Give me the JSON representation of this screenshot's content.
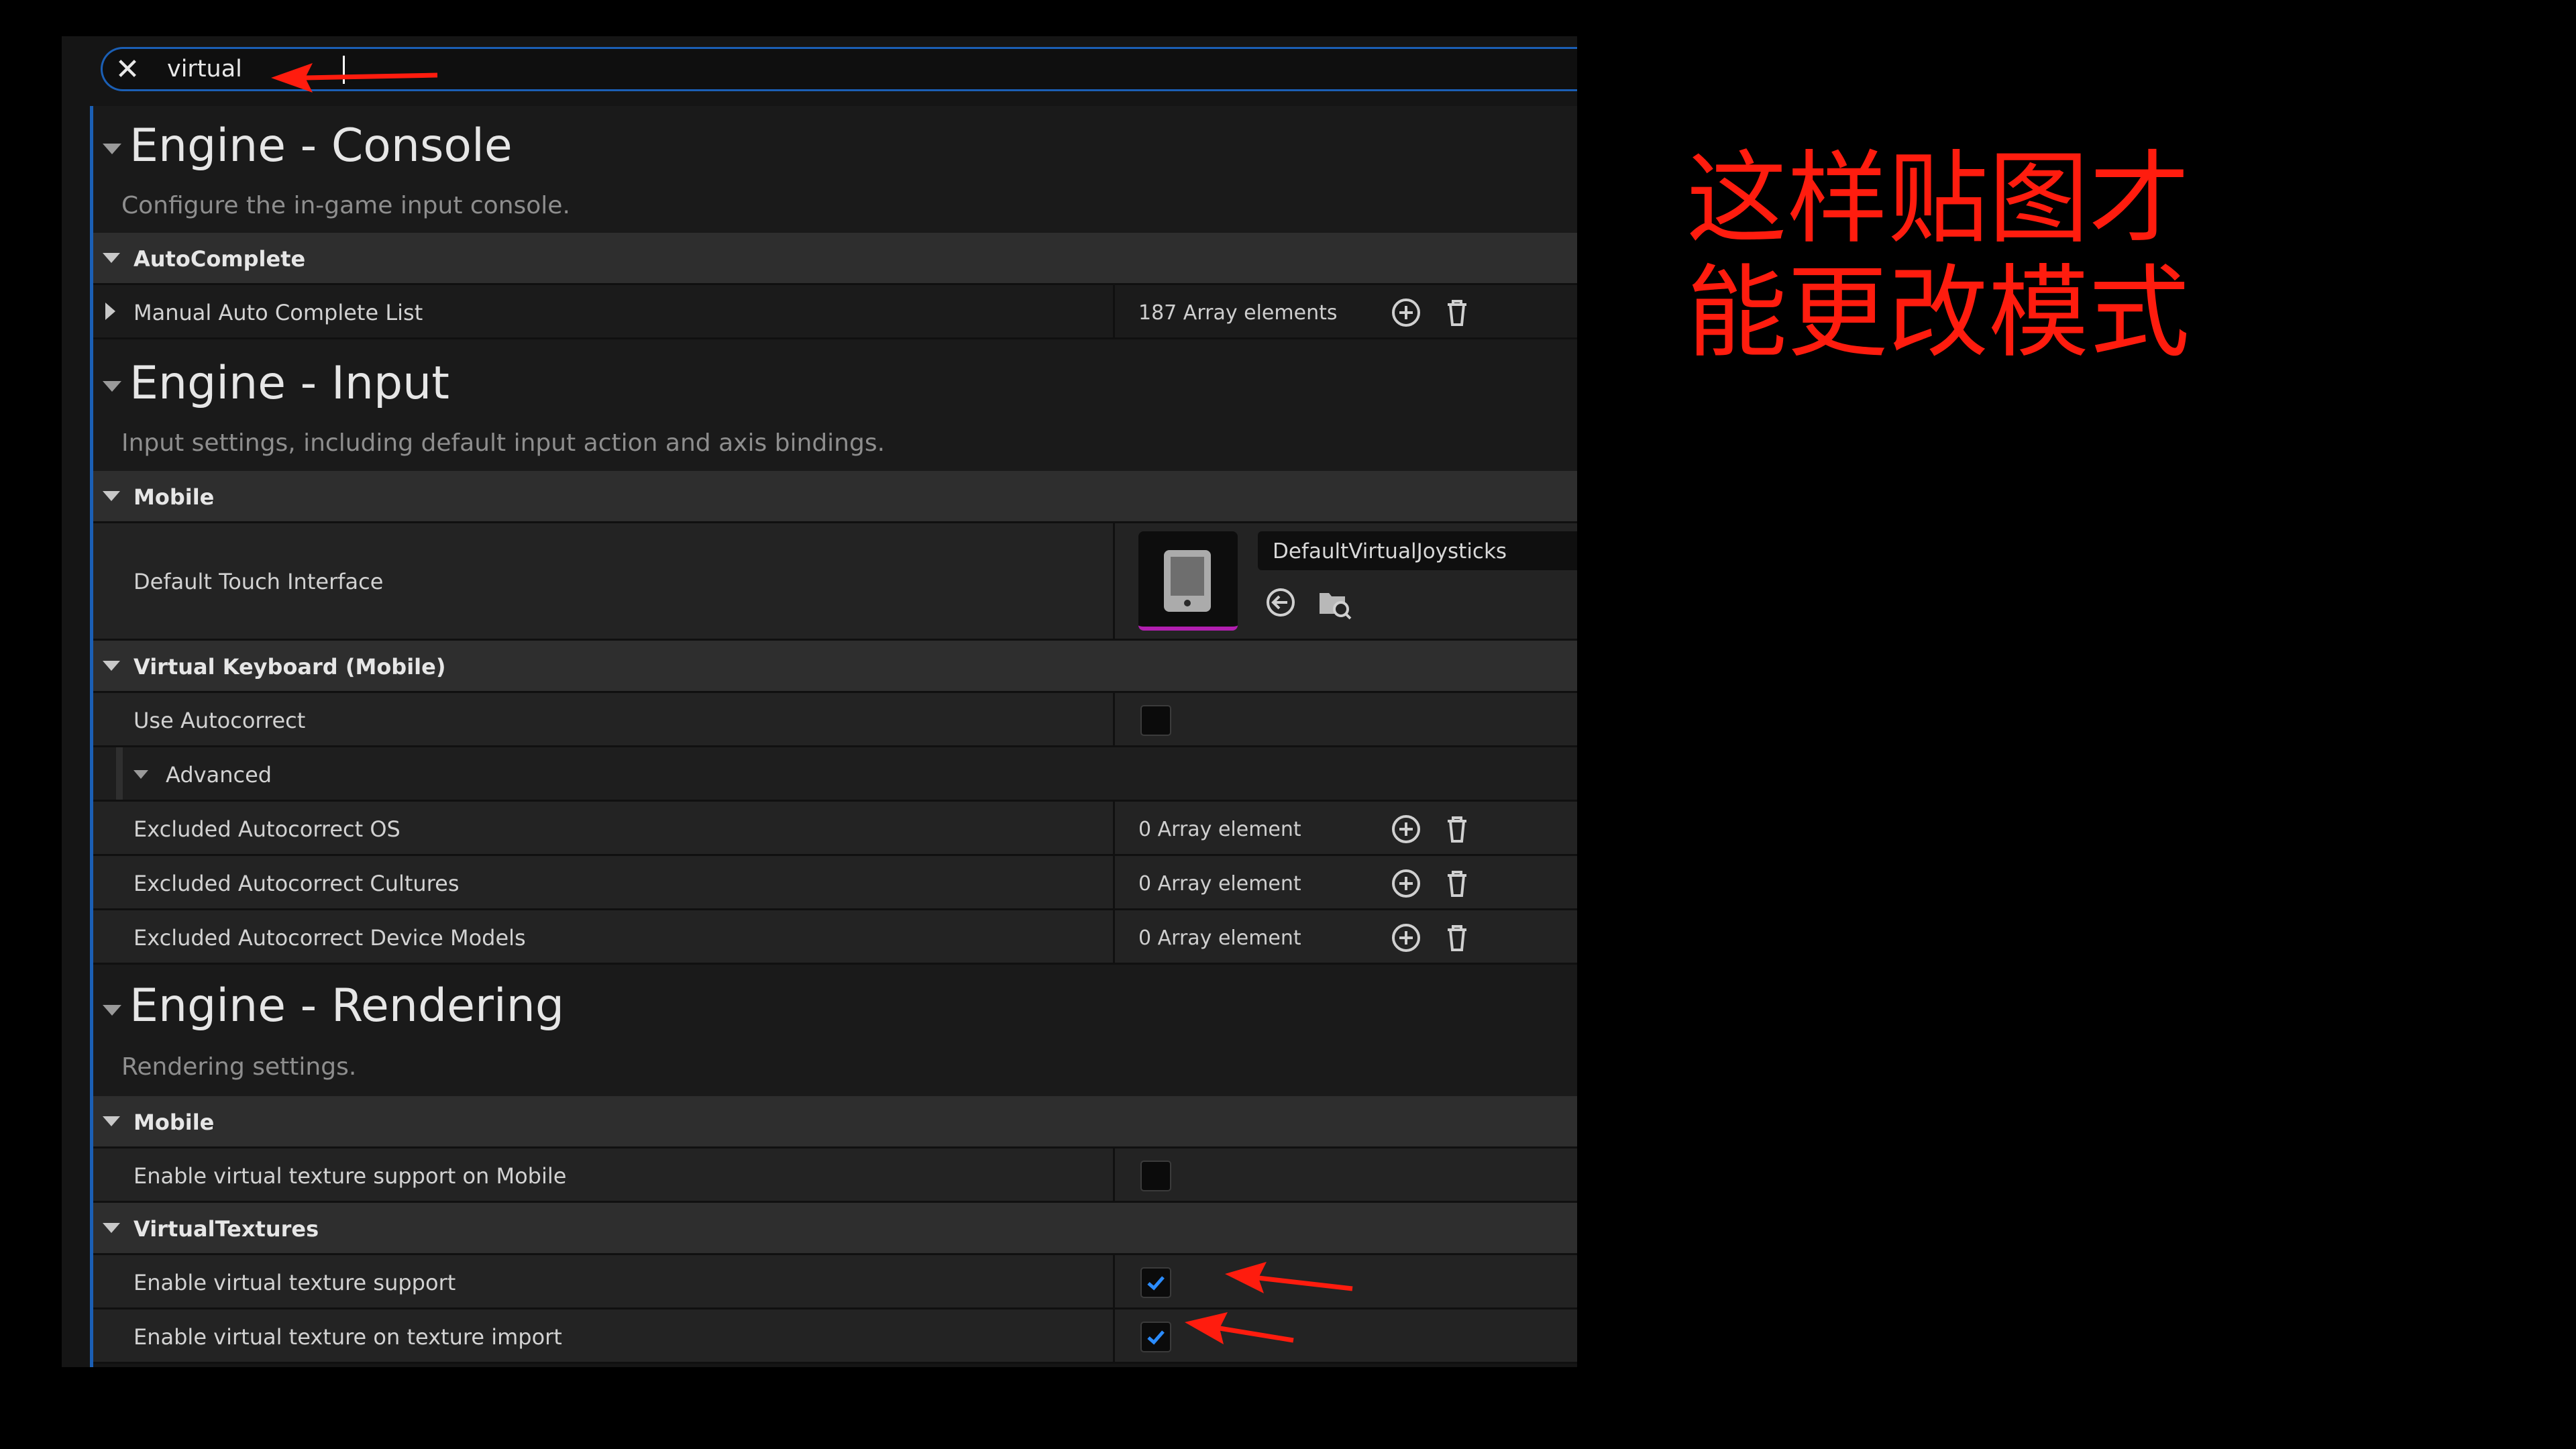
{
  "search": {
    "value": "virtual"
  },
  "sections": [
    {
      "title": "Engine - Console",
      "description": "Configure the in-game input console.",
      "categories": [
        {
          "label": "AutoComplete",
          "rows": [
            {
              "label": "Manual Auto Complete List",
              "value": "187 Array elements"
            }
          ]
        }
      ]
    },
    {
      "title": "Engine - Input",
      "description": "Input settings, including default input action and axis bindings.",
      "categories": [
        {
          "label": "Mobile",
          "rows": [
            {
              "label": "Default Touch Interface",
              "value": "DefaultVirtualJoysticks"
            }
          ]
        },
        {
          "label": "Virtual Keyboard (Mobile)",
          "rows": [
            {
              "label": "Use Autocorrect",
              "checked": false
            },
            {
              "label": "Advanced"
            },
            {
              "label": "Excluded Autocorrect OS",
              "value": "0 Array element"
            },
            {
              "label": "Excluded Autocorrect Cultures",
              "value": "0 Array element"
            },
            {
              "label": "Excluded Autocorrect Device Models",
              "value": "0 Array element"
            }
          ]
        }
      ]
    },
    {
      "title": "Engine - Rendering",
      "description": "Rendering settings.",
      "categories": [
        {
          "label": "Mobile",
          "rows": [
            {
              "label": "Enable virtual texture support on Mobile",
              "checked": false
            }
          ]
        },
        {
          "label": "VirtualTextures",
          "rows": [
            {
              "label": "Enable virtual texture support",
              "checked": true
            },
            {
              "label": "Enable virtual texture on texture import",
              "checked": true
            }
          ]
        }
      ]
    }
  ],
  "annotation": {
    "line1": "这样贴图才",
    "line2": "能更改模式",
    "color": "#ff1c0e"
  },
  "colors": {
    "accent": "#1b5fb5",
    "check": "#2b8cff",
    "asset_underline": "#b21fb0"
  }
}
